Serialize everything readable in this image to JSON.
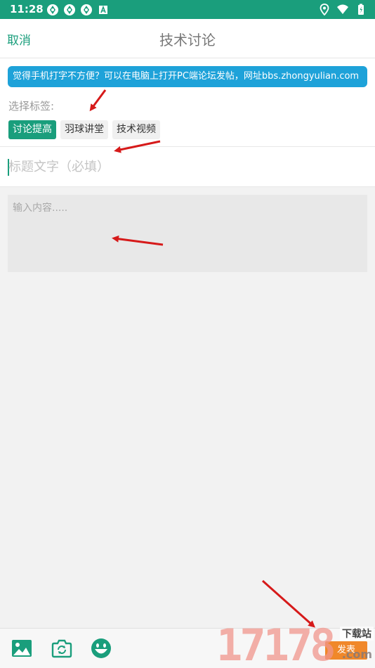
{
  "status_bar": {
    "time": "11:28",
    "left_icons": [
      "app-icon",
      "app-icon",
      "app-icon",
      "notification-a-icon"
    ],
    "right_icons": [
      "location-icon",
      "wifi-icon",
      "battery-icon"
    ]
  },
  "header": {
    "cancel_label": "取消",
    "title": "技术讨论"
  },
  "notice": {
    "text": "觉得手机打字不方便？可以在电脑上打开PC端论坛发帖，网址bbs.zhongyulian.com"
  },
  "tags": {
    "label": "选择标签:",
    "items": [
      {
        "label": "讨论提高",
        "selected": true
      },
      {
        "label": "羽球讲堂",
        "selected": false
      },
      {
        "label": "技术视频",
        "selected": false
      }
    ]
  },
  "form": {
    "title_placeholder": "标题文字（必填）",
    "body_placeholder": "输入内容....."
  },
  "bottom_bar": {
    "icons": [
      "image-icon",
      "camera-icon",
      "emoji-icon"
    ],
    "publish_label": "发表"
  },
  "watermark": {
    "digits": "17178",
    "text": "下载站",
    "suffix": ".com"
  },
  "colors": {
    "accent": "#1a9e7c",
    "notice": "#1ea2d9",
    "publish": "#f0882a",
    "annotation_arrow": "#d61a1a"
  }
}
